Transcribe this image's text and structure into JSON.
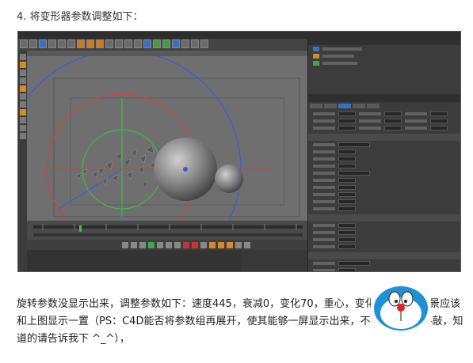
{
  "heading": "4. 将变形器参数调整如下：",
  "paragraph": "旋转参数没显示出来，调整参数如下：速度445，衰减0，变化70，重心，变化75，你的场景应该和上图显示一置（PS：C4D能否将参数组再展开，使其能够一屏显示出来，不用再截屏或手敲，知道的请告诉我下 ^_^），",
  "colors": {
    "viewport_bg": "#6f6f6f",
    "panel_bg": "#3c3c3c",
    "axis_x": "#e23a3a",
    "axis_y": "#3fc13f",
    "axis_z": "#3a5be0",
    "accent_blue": "#3d6ec8",
    "accent_orange": "#d48b2a"
  },
  "icons": [
    "toolbar-icon",
    "tool-icon",
    "play-icon",
    "record-icon",
    "sphere-object",
    "doraemon-mascot"
  ]
}
